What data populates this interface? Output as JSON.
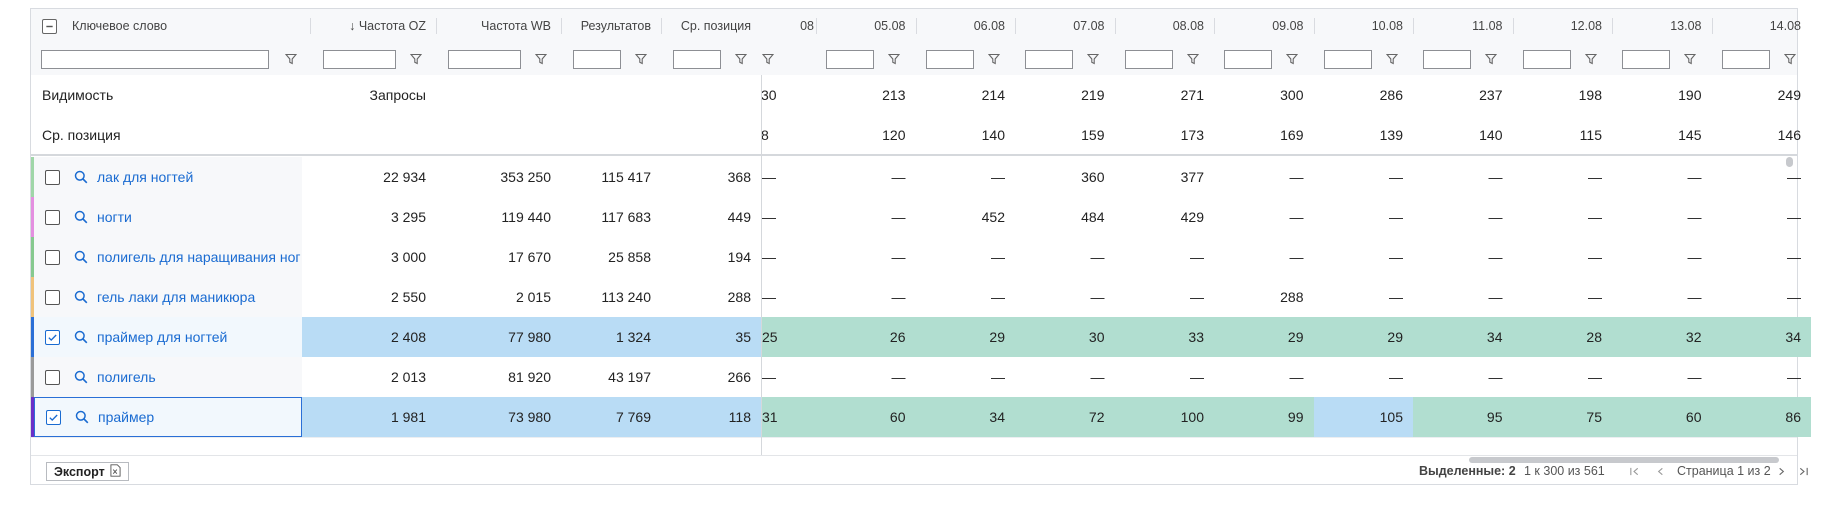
{
  "columns": {
    "keyword": "Ключевое слово",
    "freq_oz": "↓ Частота OZ",
    "freq_wb": "Частота WB",
    "results": "Результатов",
    "avg_pos": "Ср. позиция",
    "partial_date": "08",
    "dates": [
      "05.08",
      "06.08",
      "07.08",
      "08.08",
      "09.08",
      "10.08",
      "11.08",
      "12.08",
      "13.08",
      "14.08"
    ]
  },
  "pinned": [
    {
      "label": "Видимость",
      "sub": "Запросы",
      "partial": "30",
      "values": [
        "213",
        "214",
        "219",
        "271",
        "300",
        "286",
        "237",
        "198",
        "190",
        "249"
      ]
    },
    {
      "label": "Ср. позиция",
      "sub": "",
      "partial": "8",
      "values": [
        "120",
        "140",
        "159",
        "173",
        "169",
        "139",
        "140",
        "115",
        "145",
        "146"
      ]
    }
  ],
  "rows": [
    {
      "keyword": "лак для ногтей",
      "oz": "22 934",
      "wb": "353 250",
      "res": "115 417",
      "pos": "368",
      "partial": "—",
      "dates": [
        "—",
        "—",
        "360",
        "377",
        "—",
        "—",
        "—",
        "—",
        "—",
        "—"
      ],
      "checked": false,
      "bar": "#9fd6a8"
    },
    {
      "keyword": "ногти",
      "oz": "3 295",
      "wb": "119 440",
      "res": "117 683",
      "pos": "449",
      "partial": "—",
      "dates": [
        "—",
        "452",
        "484",
        "429",
        "—",
        "—",
        "—",
        "—",
        "—",
        "—"
      ],
      "checked": false,
      "bar": "#e48fe0"
    },
    {
      "keyword": "полигель для наращивания ног",
      "oz": "3 000",
      "wb": "17 670",
      "res": "25 858",
      "pos": "194",
      "partial": "—",
      "dates": [
        "—",
        "—",
        "—",
        "—",
        "—",
        "—",
        "—",
        "—",
        "—",
        "—"
      ],
      "checked": false,
      "bar": "#86c98f"
    },
    {
      "keyword": "гель лаки для маникюра",
      "oz": "2 550",
      "wb": "2 015",
      "res": "113 240",
      "pos": "288",
      "partial": "—",
      "dates": [
        "—",
        "—",
        "—",
        "—",
        "288",
        "—",
        "—",
        "—",
        "—",
        "—"
      ],
      "checked": false,
      "bar": "#f0c27a"
    },
    {
      "keyword": "праймер для ногтей",
      "oz": "2 408",
      "wb": "77 980",
      "res": "1 324",
      "pos": "35",
      "partial": "25",
      "dates": [
        "26",
        "29",
        "30",
        "33",
        "29",
        "29",
        "34",
        "28",
        "32",
        "34"
      ],
      "checked": true,
      "bar": "#2a6fd6"
    },
    {
      "keyword": "полигель",
      "oz": "2 013",
      "wb": "81 920",
      "res": "43 197",
      "pos": "266",
      "partial": "—",
      "dates": [
        "—",
        "—",
        "—",
        "—",
        "—",
        "—",
        "—",
        "—",
        "—",
        "—"
      ],
      "checked": false,
      "bar": "#9a9a9a"
    },
    {
      "keyword": "праймер",
      "oz": "1 981",
      "wb": "73 980",
      "res": "7 769",
      "pos": "118",
      "partial": "31",
      "dates": [
        "60",
        "34",
        "72",
        "100",
        "99",
        "105",
        "95",
        "75",
        "60",
        "86"
      ],
      "checked": true,
      "bar": "#6a2fc7"
    }
  ],
  "footer": {
    "export": "Экспорт",
    "selected_label": "Выделенные:",
    "selected_count": "2",
    "range": "1 к 300 из 561",
    "page": "Страница 1 из 2"
  },
  "colors": {
    "accent": "#1a6bd1",
    "selected_row": "#b9dcf5",
    "green_cell": "#b1ded0"
  }
}
